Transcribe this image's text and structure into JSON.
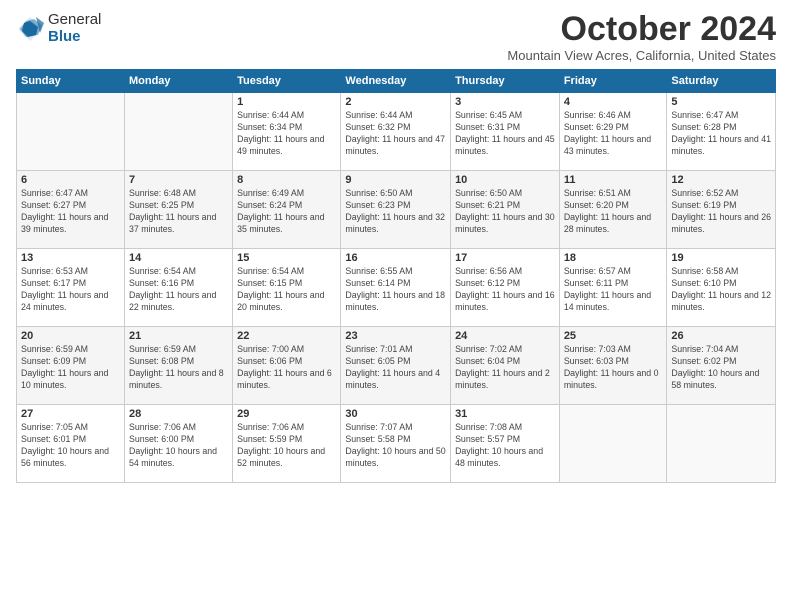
{
  "logo": {
    "line1": "General",
    "line2": "Blue"
  },
  "header": {
    "title": "October 2024",
    "location": "Mountain View Acres, California, United States"
  },
  "days_of_week": [
    "Sunday",
    "Monday",
    "Tuesday",
    "Wednesday",
    "Thursday",
    "Friday",
    "Saturday"
  ],
  "weeks": [
    [
      {
        "day": "",
        "detail": ""
      },
      {
        "day": "",
        "detail": ""
      },
      {
        "day": "1",
        "detail": "Sunrise: 6:44 AM\nSunset: 6:34 PM\nDaylight: 11 hours and 49 minutes."
      },
      {
        "day": "2",
        "detail": "Sunrise: 6:44 AM\nSunset: 6:32 PM\nDaylight: 11 hours and 47 minutes."
      },
      {
        "day": "3",
        "detail": "Sunrise: 6:45 AM\nSunset: 6:31 PM\nDaylight: 11 hours and 45 minutes."
      },
      {
        "day": "4",
        "detail": "Sunrise: 6:46 AM\nSunset: 6:29 PM\nDaylight: 11 hours and 43 minutes."
      },
      {
        "day": "5",
        "detail": "Sunrise: 6:47 AM\nSunset: 6:28 PM\nDaylight: 11 hours and 41 minutes."
      }
    ],
    [
      {
        "day": "6",
        "detail": "Sunrise: 6:47 AM\nSunset: 6:27 PM\nDaylight: 11 hours and 39 minutes."
      },
      {
        "day": "7",
        "detail": "Sunrise: 6:48 AM\nSunset: 6:25 PM\nDaylight: 11 hours and 37 minutes."
      },
      {
        "day": "8",
        "detail": "Sunrise: 6:49 AM\nSunset: 6:24 PM\nDaylight: 11 hours and 35 minutes."
      },
      {
        "day": "9",
        "detail": "Sunrise: 6:50 AM\nSunset: 6:23 PM\nDaylight: 11 hours and 32 minutes."
      },
      {
        "day": "10",
        "detail": "Sunrise: 6:50 AM\nSunset: 6:21 PM\nDaylight: 11 hours and 30 minutes."
      },
      {
        "day": "11",
        "detail": "Sunrise: 6:51 AM\nSunset: 6:20 PM\nDaylight: 11 hours and 28 minutes."
      },
      {
        "day": "12",
        "detail": "Sunrise: 6:52 AM\nSunset: 6:19 PM\nDaylight: 11 hours and 26 minutes."
      }
    ],
    [
      {
        "day": "13",
        "detail": "Sunrise: 6:53 AM\nSunset: 6:17 PM\nDaylight: 11 hours and 24 minutes."
      },
      {
        "day": "14",
        "detail": "Sunrise: 6:54 AM\nSunset: 6:16 PM\nDaylight: 11 hours and 22 minutes."
      },
      {
        "day": "15",
        "detail": "Sunrise: 6:54 AM\nSunset: 6:15 PM\nDaylight: 11 hours and 20 minutes."
      },
      {
        "day": "16",
        "detail": "Sunrise: 6:55 AM\nSunset: 6:14 PM\nDaylight: 11 hours and 18 minutes."
      },
      {
        "day": "17",
        "detail": "Sunrise: 6:56 AM\nSunset: 6:12 PM\nDaylight: 11 hours and 16 minutes."
      },
      {
        "day": "18",
        "detail": "Sunrise: 6:57 AM\nSunset: 6:11 PM\nDaylight: 11 hours and 14 minutes."
      },
      {
        "day": "19",
        "detail": "Sunrise: 6:58 AM\nSunset: 6:10 PM\nDaylight: 11 hours and 12 minutes."
      }
    ],
    [
      {
        "day": "20",
        "detail": "Sunrise: 6:59 AM\nSunset: 6:09 PM\nDaylight: 11 hours and 10 minutes."
      },
      {
        "day": "21",
        "detail": "Sunrise: 6:59 AM\nSunset: 6:08 PM\nDaylight: 11 hours and 8 minutes."
      },
      {
        "day": "22",
        "detail": "Sunrise: 7:00 AM\nSunset: 6:06 PM\nDaylight: 11 hours and 6 minutes."
      },
      {
        "day": "23",
        "detail": "Sunrise: 7:01 AM\nSunset: 6:05 PM\nDaylight: 11 hours and 4 minutes."
      },
      {
        "day": "24",
        "detail": "Sunrise: 7:02 AM\nSunset: 6:04 PM\nDaylight: 11 hours and 2 minutes."
      },
      {
        "day": "25",
        "detail": "Sunrise: 7:03 AM\nSunset: 6:03 PM\nDaylight: 11 hours and 0 minutes."
      },
      {
        "day": "26",
        "detail": "Sunrise: 7:04 AM\nSunset: 6:02 PM\nDaylight: 10 hours and 58 minutes."
      }
    ],
    [
      {
        "day": "27",
        "detail": "Sunrise: 7:05 AM\nSunset: 6:01 PM\nDaylight: 10 hours and 56 minutes."
      },
      {
        "day": "28",
        "detail": "Sunrise: 7:06 AM\nSunset: 6:00 PM\nDaylight: 10 hours and 54 minutes."
      },
      {
        "day": "29",
        "detail": "Sunrise: 7:06 AM\nSunset: 5:59 PM\nDaylight: 10 hours and 52 minutes."
      },
      {
        "day": "30",
        "detail": "Sunrise: 7:07 AM\nSunset: 5:58 PM\nDaylight: 10 hours and 50 minutes."
      },
      {
        "day": "31",
        "detail": "Sunrise: 7:08 AM\nSunset: 5:57 PM\nDaylight: 10 hours and 48 minutes."
      },
      {
        "day": "",
        "detail": ""
      },
      {
        "day": "",
        "detail": ""
      }
    ]
  ]
}
